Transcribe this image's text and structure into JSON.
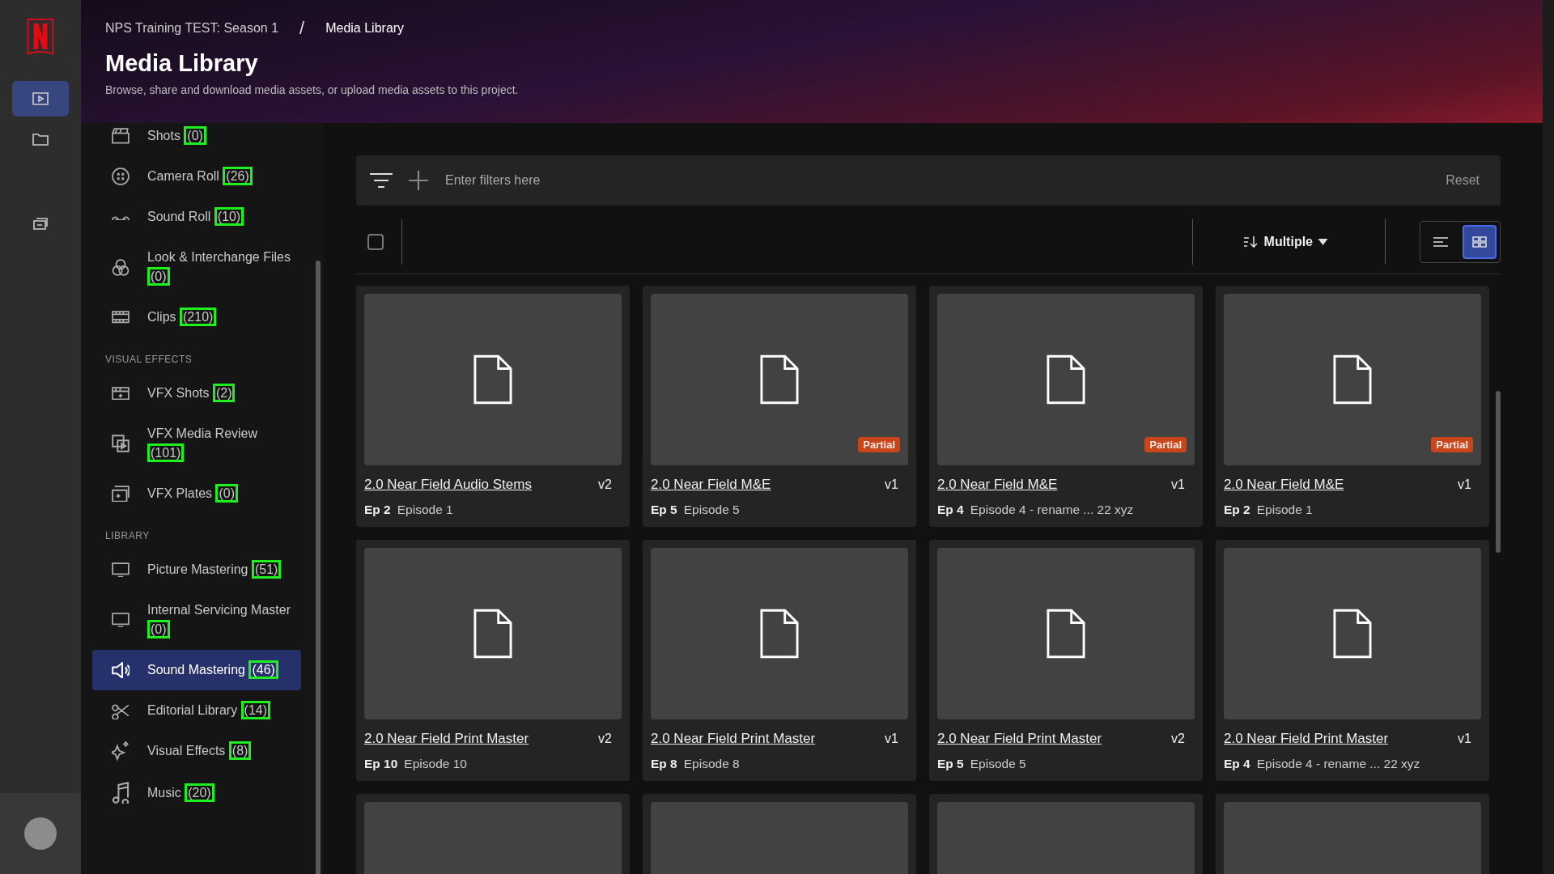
{
  "breadcrumb": [
    "NPS Training TEST: Season 1",
    "Media Library"
  ],
  "breadcrumb_separator": "/",
  "header": {
    "title": "Media Library",
    "subtitle": "Browse, share and download media assets, or upload media assets to this project."
  },
  "rail": [
    {
      "selected": true
    },
    {
      "selected": false
    },
    {
      "selected": false
    }
  ],
  "sidebar": [
    {
      "kind": "item",
      "label": "Shots",
      "count": "(0)",
      "selected": false
    },
    {
      "kind": "item",
      "label": "Camera Roll",
      "count": "(26)",
      "selected": false
    },
    {
      "kind": "item",
      "label": "Sound Roll",
      "count": "(10)",
      "selected": false
    },
    {
      "kind": "item",
      "label": "Look & Interchange Files",
      "count": "(0)",
      "selected": false
    },
    {
      "kind": "item",
      "label": "Clips",
      "count": "(210)",
      "selected": false
    },
    {
      "kind": "section",
      "label": "VISUAL EFFECTS"
    },
    {
      "kind": "item",
      "label": "VFX Shots",
      "count": "(2)",
      "selected": false
    },
    {
      "kind": "item",
      "label": "VFX Media Review",
      "count": "(101)",
      "selected": false
    },
    {
      "kind": "item",
      "label": "VFX Plates",
      "count": "(0)",
      "selected": false
    },
    {
      "kind": "section",
      "label": "LIBRARY"
    },
    {
      "kind": "item",
      "label": "Picture Mastering",
      "count": "(51)",
      "selected": false
    },
    {
      "kind": "item",
      "label": "Internal Servicing Master",
      "count": "(0)",
      "selected": false
    },
    {
      "kind": "item",
      "label": "Sound Mastering",
      "count": "(46)",
      "selected": true
    },
    {
      "kind": "item",
      "label": "Editorial Library",
      "count": "(14)",
      "selected": false
    },
    {
      "kind": "item",
      "label": "Visual Effects",
      "count": "(8)",
      "selected": false
    },
    {
      "kind": "item",
      "label": "Music",
      "count": "(20)",
      "selected": false
    }
  ],
  "filter": {
    "placeholder": "Enter filters here",
    "reset": "Reset"
  },
  "toolbar": {
    "checked": false,
    "sort": "Multiple",
    "views": [
      {
        "kind": "list",
        "selected": false
      },
      {
        "kind": "grid",
        "selected": true
      }
    ]
  },
  "cards": [
    {
      "kind": "asset",
      "title": "2.0 Near Field Audio Stems",
      "version": "v2",
      "ep": "Ep 2",
      "episode": "Episode 1"
    },
    {
      "kind": "asset",
      "title": "2.0 Near Field M&E",
      "version": "v1",
      "ep": "Ep 5",
      "episode": "Episode 5",
      "badge": "Partial"
    },
    {
      "kind": "asset",
      "title": "2.0 Near Field M&E",
      "version": "v1",
      "ep": "Ep 4",
      "episode": "Episode 4 - rename ... 22 xyz",
      "badge": "Partial"
    },
    {
      "kind": "asset",
      "title": "2.0 Near Field M&E",
      "version": "v1",
      "ep": "Ep 2",
      "episode": "Episode 1",
      "badge": "Partial"
    },
    {
      "kind": "asset",
      "title": "2.0 Near Field Print Master",
      "version": "v2",
      "ep": "Ep 10",
      "episode": "Episode 10"
    },
    {
      "kind": "asset",
      "title": "2.0 Near Field Print Master",
      "version": "v1",
      "ep": "Ep 8",
      "episode": "Episode 8"
    },
    {
      "kind": "asset",
      "title": "2.0 Near Field Print Master",
      "version": "v2",
      "ep": "Ep 5",
      "episode": "Episode 5"
    },
    {
      "kind": "asset",
      "title": "2.0 Near Field Print Master",
      "version": "v1",
      "ep": "Ep 4",
      "episode": "Episode 4 - rename ... 22 xyz"
    },
    {
      "kind": "stub"
    },
    {
      "kind": "stub"
    },
    {
      "kind": "stub"
    },
    {
      "kind": "stub"
    }
  ]
}
